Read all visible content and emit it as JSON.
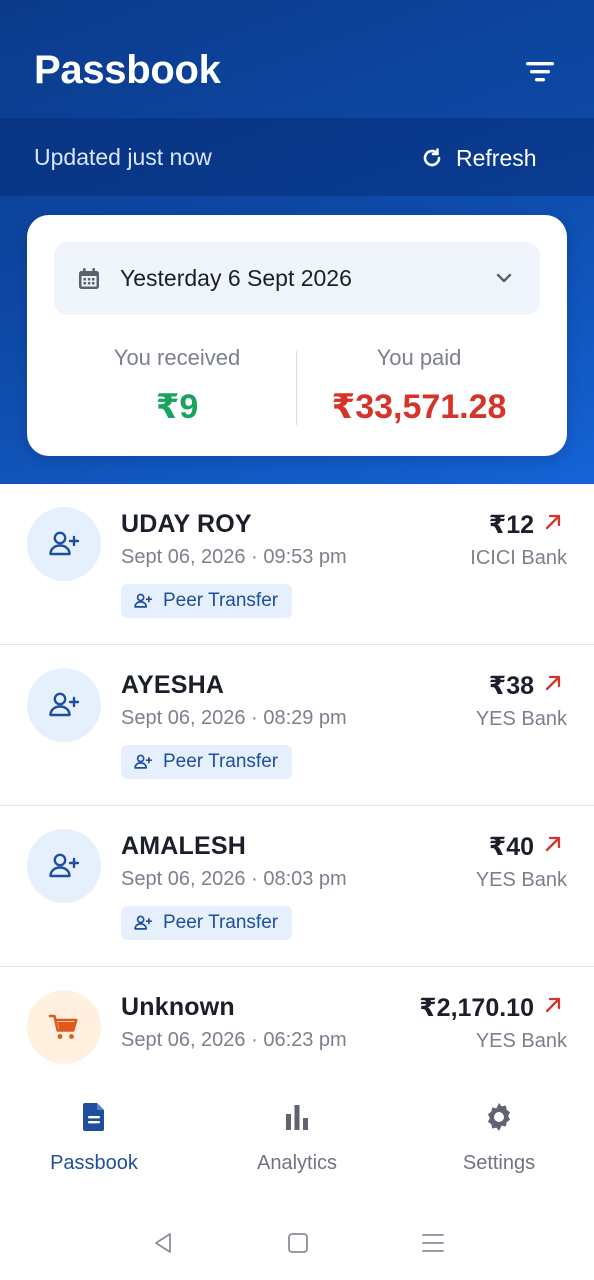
{
  "header": {
    "title": "Passbook",
    "filter_icon": "filter-icon"
  },
  "update_bar": {
    "status": "Updated just now",
    "refresh_label": "Refresh"
  },
  "summary": {
    "date_label": "Yesterday 6 Sept 2026",
    "received_label": "You received",
    "received_value": "₹9",
    "paid_label": "You paid",
    "paid_value": "₹33,571.28"
  },
  "transactions": [
    {
      "name": "UDAY ROY",
      "datetime": "Sept 06, 2026 · 09:53 pm",
      "amount": "₹12",
      "bank": "ICICI Bank",
      "tag": "Peer Transfer",
      "icon": "add-person-icon"
    },
    {
      "name": "AYESHA",
      "datetime": "Sept 06, 2026 · 08:29 pm",
      "amount": "₹38",
      "bank": "YES Bank",
      "tag": "Peer Transfer",
      "icon": "add-person-icon"
    },
    {
      "name": "AMALESH",
      "datetime": "Sept 06, 2026 · 08:03 pm",
      "amount": "₹40",
      "bank": "YES Bank",
      "tag": "Peer Transfer",
      "icon": "add-person-icon"
    },
    {
      "name": "Unknown",
      "datetime": "Sept 06, 2026 · 06:23 pm",
      "amount": "₹2,170.10",
      "bank": "YES Bank",
      "icon": "cart-icon"
    }
  ],
  "bottom_nav": [
    {
      "label": "Passbook",
      "icon": "document-icon",
      "active": true
    },
    {
      "label": "Analytics",
      "icon": "bar-chart-icon",
      "active": false
    },
    {
      "label": "Settings",
      "icon": "gear-icon",
      "active": false
    }
  ],
  "colors": {
    "header_top": "#0b3a8a",
    "header_bottom": "#1463d6",
    "received": "#1aa35c",
    "paid": "#d6332b",
    "accent": "#1d4f9e"
  }
}
